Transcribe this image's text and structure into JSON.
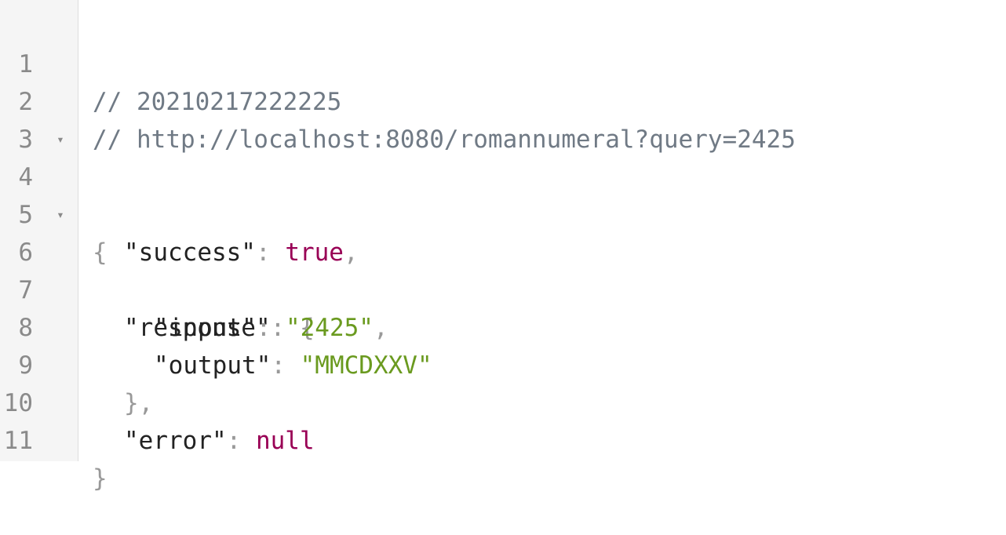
{
  "line_numbers": [
    "1",
    "2",
    "3",
    "4",
    "5",
    "6",
    "7",
    "8",
    "9",
    "10",
    "11"
  ],
  "fold_icon": "▾",
  "comment_timestamp": "// 20210217222225",
  "comment_url": "// http://localhost:8080/romannumeral?query=2425",
  "open_brace": "{",
  "close_brace": "}",
  "fields": {
    "success_key": "\"success\"",
    "success_value": "true",
    "response_key": "\"response\"",
    "input_key": "\"input\"",
    "input_value": "\"2425\"",
    "output_key": "\"output\"",
    "output_value": "\"MMCDXXV\"",
    "response_close": "}",
    "error_key": "\"error\"",
    "error_value": "null"
  },
  "punctuation": {
    "colon": ": ",
    "comma": ","
  }
}
